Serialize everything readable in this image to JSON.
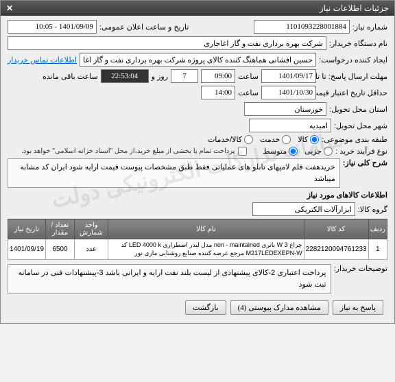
{
  "window": {
    "title": "جزئیات اطلاعات نیاز",
    "close": "✕"
  },
  "fields": {
    "need_no_label": "شماره نیاز:",
    "need_no": "1101093228001884",
    "announce_label": "تاریخ و ساعت اعلان عمومی:",
    "announce": "1401/09/09 - 10:05",
    "device_label": "نام دستگاه خریدار:",
    "device": "شرکت بهره برداری نفت و گاز اغاجاری",
    "requester_label": "ایجاد کننده درخواست:",
    "requester": "حسین افشانی هماهنگ کننده کالای پروژه شرکت بهره برداری نفت و گاز اغاجاری",
    "contact_link": "اطلاعات تماس خریدار",
    "deadline_sent_label": "مهلت ارسال پاسخ: تا تاریخ:",
    "deadline_date": "1401/09/17",
    "deadline_time_label": "ساعت",
    "deadline_time": "09:00",
    "days_value": "7",
    "days_label": "روز و",
    "remain_time": "22:53:04",
    "remain_label": "ساعت باقی مانده",
    "validity_label": "حداقل تاریخ اعتبار قیمت: تا تاریخ:",
    "validity_date": "1401/10/30",
    "validity_time_label": "ساعت",
    "validity_time": "14:00",
    "province_label": "استان محل تحویل:",
    "province": "خوزستان",
    "city_label": "شهر محل تحویل:",
    "city": "امیدیه",
    "category_label": "طبقه بندی موضوعی:",
    "purchase_type_label": "نوع فرآیند خرید :",
    "payment_note": "پرداخت تمام یا بخشی از مبلغ خرید،از محل \"اسناد خزانه اسلامی\" خواهد بود."
  },
  "radios": {
    "r1": "کالا",
    "r2": "خدمت",
    "r3": "کالا/خدمات",
    "p1": "جزیی",
    "p2": "متوسط"
  },
  "desc": {
    "title": "شرح کلی نیاز:",
    "text": "خریدهفت قلم لامپهای تابلو های عملیاتی فقط طبق مشخصات پیوست قیمت ارایه شود ایران کد مشابه میباشد"
  },
  "goods": {
    "title": "اطلاعات کالاهای مورد نیاز",
    "group_label": "گروه کالا:",
    "group_value": "ابزارآلات الکتریکی"
  },
  "table": {
    "headers": [
      "ردیف",
      "کد کالا",
      "نام کالا",
      "واحد شمارش",
      "تعداد / مقدار",
      "تاریخ نیاز"
    ],
    "rows": [
      {
        "idx": "1",
        "code": "2282120094761233",
        "name": "چراغ W 3 باتری non - maintained مدل لیدر اضطراری LED 4000 k کد M217LEDEXEPN-W مرجع عرضه کننده صنایع روشنایی مازی نور",
        "unit": "عدد",
        "qty": "6500",
        "date": "1401/09/19"
      }
    ]
  },
  "notes": {
    "label": "توضیحات خریدار:",
    "text": "پرداخت اعتباری 2-کالای پیشنهادی از لیست بلند نفت ارایه و ایرانی باشد 3-پیشنهادات فنی در سامانه ثبت شود"
  },
  "buttons": {
    "reply": "پاسخ به نیاز",
    "attachments": "مشاهده مدارک پیوستی (4)",
    "back": "بازگشت"
  },
  "watermark": "سامانه تدارکات الکترونیکی دولت"
}
